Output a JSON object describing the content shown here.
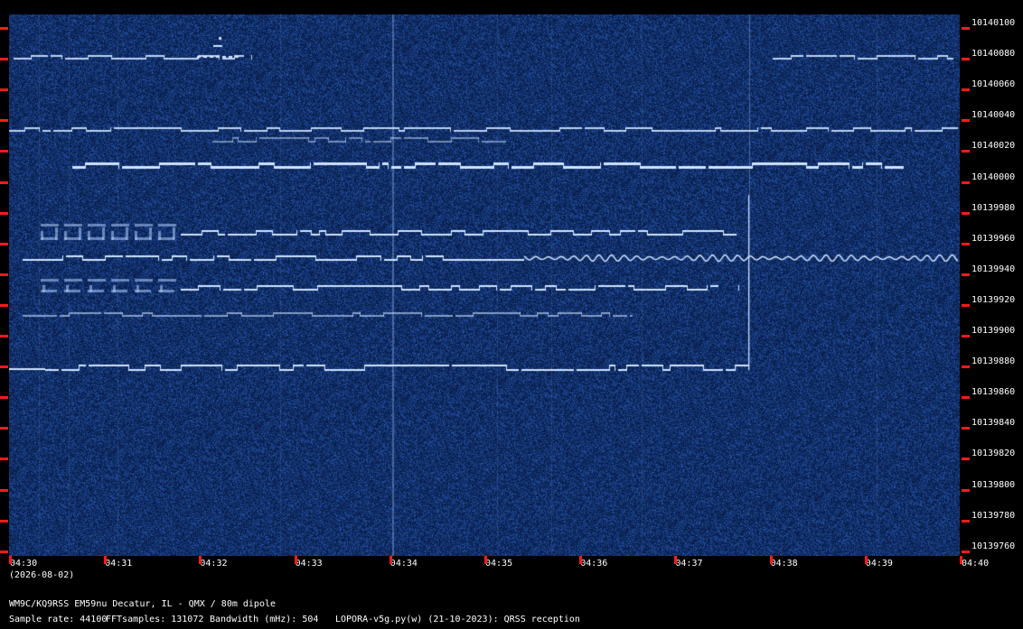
{
  "frequency_axis": {
    "labels": [
      "10140100",
      "10140080",
      "10140060",
      "10140040",
      "10140020",
      "10140000",
      "10139980",
      "10139960",
      "10139940",
      "10139920",
      "10139900",
      "10139880",
      "10139860",
      "10139840",
      "10139820",
      "10139800",
      "10139780",
      "10139760"
    ]
  },
  "time_axis": {
    "labels": [
      "04:30",
      "04:31",
      "04:32",
      "04:33",
      "04:34",
      "04:35",
      "04:36",
      "04:37",
      "04:38",
      "04:39",
      "04:40"
    ],
    "date": "(2026-08-02)"
  },
  "footer": {
    "station": "WM9C/KQ9RSS EM59nu Decatur, IL - QMX / 80m dipole",
    "sample_rate": "Sample rate: 44100",
    "fft_samples": "FFTsamples: 131072",
    "bandwidth": "Bandwidth (mHz): 504",
    "software": "LOPORA-v5g.py(w) (21-10-2023): QRSS reception"
  },
  "colors": {
    "background": "#000000",
    "waterfall_base": "#0d2553",
    "signal": "#cfe4ff",
    "tick": "#ff1a1a",
    "text": "#ffffff"
  }
}
